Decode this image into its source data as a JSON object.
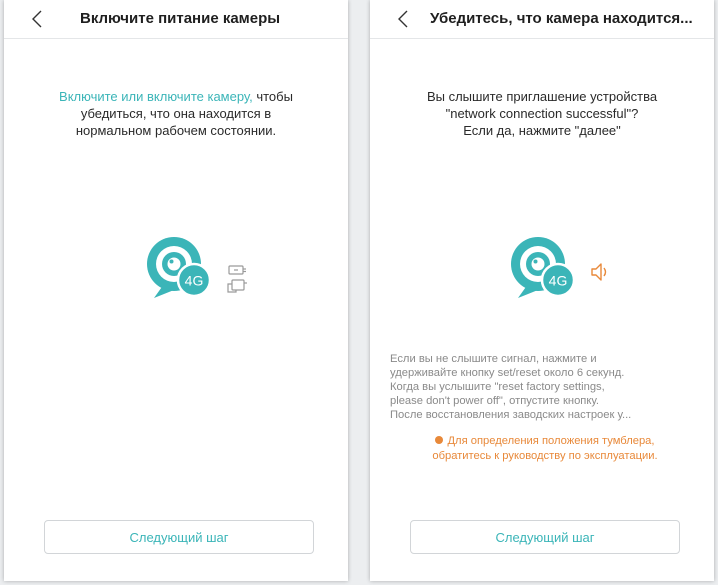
{
  "screens": {
    "left": {
      "title": "Включите питание камеры",
      "instruction_highlight": "Включите или включите камеру,",
      "instruction_line1_rest": " чтобы",
      "instruction_line2": "убедиться, что она находится в",
      "instruction_line3": "нормальном рабочем состоянии.",
      "camera_badge": "4G",
      "next_label": "Следующий шаг"
    },
    "right": {
      "title": "Убедитесь, что камера находится...",
      "prompt_line1": "Вы слышите приглашение устройства",
      "prompt_line2": "\"network connection successful\"?",
      "prompt_line3": "Если да, нажмите \"далее\"",
      "camera_badge": "4G",
      "hint_line1": "Если вы не слышите сигнал, нажмите и",
      "hint_line2": "удерживайте кнопку set/reset около 6 секунд.",
      "hint_line3": "Когда вы услышите \"reset factory settings,",
      "hint_line4": "please don't power off\", отпустите кнопку.",
      "hint_line5": "После восстановления заводских настроек у...",
      "warning_line1": "Для определения положения тумблера,",
      "warning_line2": "обратитесь к руководству по эксплуатации.",
      "next_label": "Следующий шаг"
    }
  },
  "icons": {
    "back": "chevron-left-icon",
    "camera": "camera-4g-icon",
    "power_switch": "power-switch-icon",
    "speaker": "speaker-icon"
  },
  "colors": {
    "accent": "#3bb5b8",
    "warning": "#e8893a",
    "text": "#1f1f1f",
    "hint": "#8a8a8a"
  }
}
